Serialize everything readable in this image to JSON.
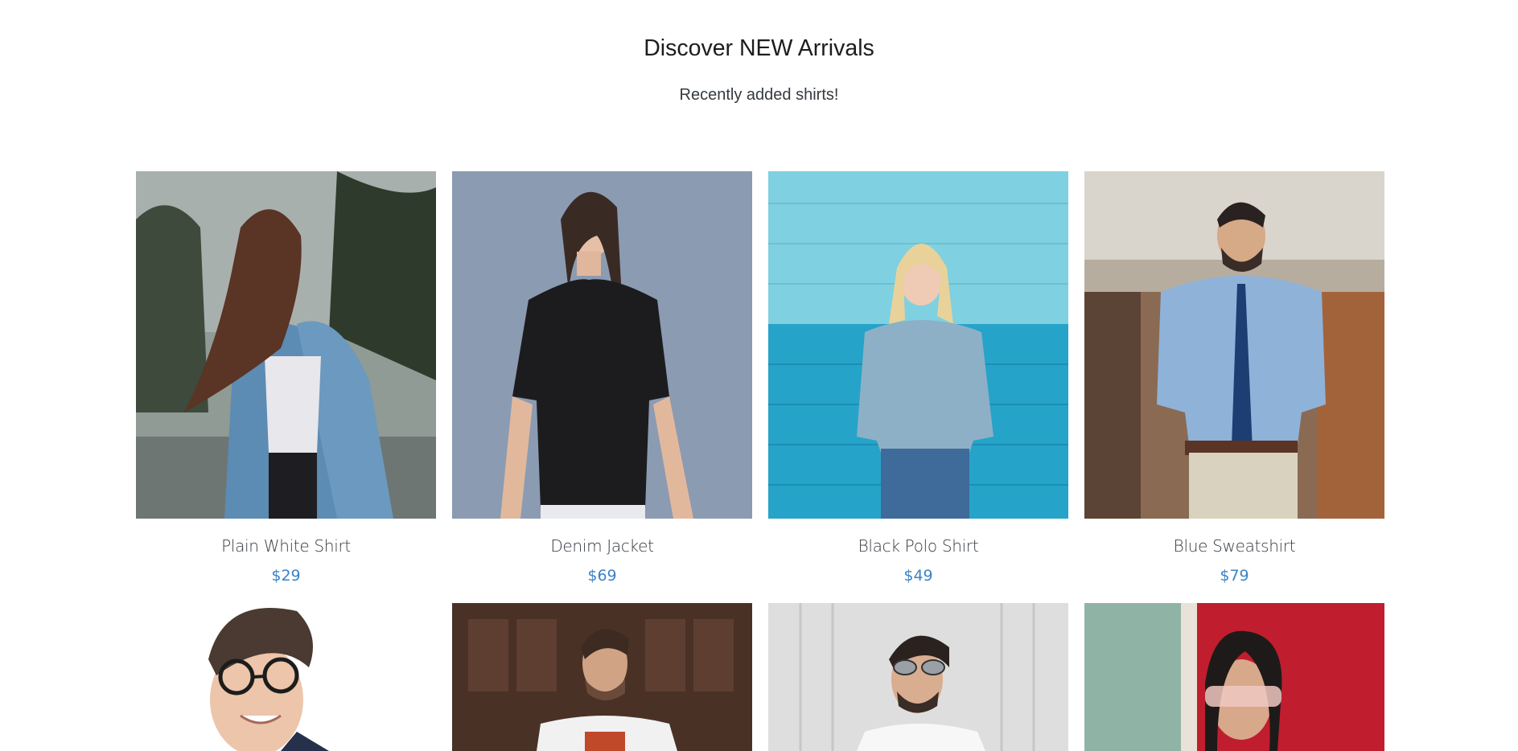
{
  "header": {
    "title": "Discover NEW Arrivals",
    "subtitle": "Recently added shirts!"
  },
  "colors": {
    "price": "#3b82c4",
    "text": "#343a40"
  },
  "products": [
    {
      "name": "Plain White Shirt",
      "price": "$29",
      "image_icon": "woman-denim-jacket-photo"
    },
    {
      "name": "Denim Jacket",
      "price": "$69",
      "image_icon": "woman-black-polo-photo"
    },
    {
      "name": "Black Polo Shirt",
      "price": "$49",
      "image_icon": "woman-sweatshirt-blue-wall-photo"
    },
    {
      "name": "Blue Sweatshirt",
      "price": "$79",
      "image_icon": "man-blue-shirt-tie-photo"
    },
    {
      "image_icon": "man-glasses-portrait-photo"
    },
    {
      "image_icon": "man-white-tee-wooden-door-photo"
    },
    {
      "image_icon": "man-sunglasses-white-shirt-photo"
    },
    {
      "image_icon": "woman-red-wall-sunglasses-photo"
    }
  ]
}
